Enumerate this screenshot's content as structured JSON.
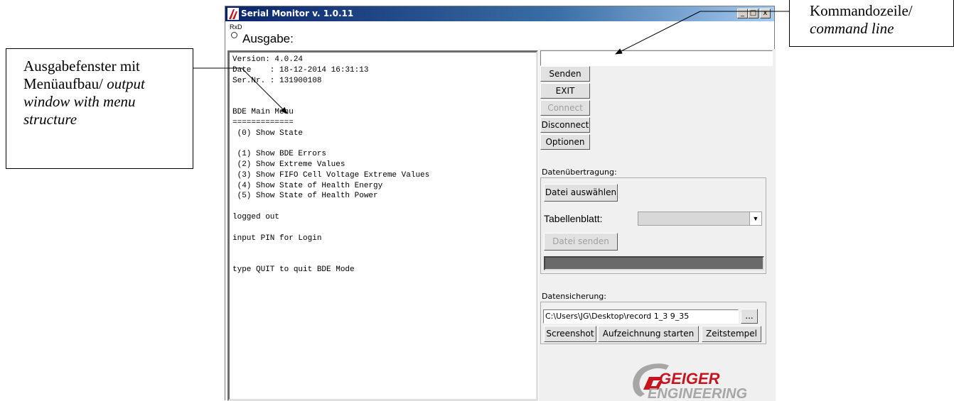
{
  "window": {
    "title": "Serial Monitor v. 1.0.11",
    "controls": {
      "minimize": "_",
      "maximize": "□",
      "close": "x"
    }
  },
  "status": {
    "rxd_label": "RxD"
  },
  "output_label": "Ausgabe:",
  "output_text": "Version: 4.0.24\nDate    : 18-12-2014 16:31:13\nSer.Nr. : 131900108\n\n\nBDE Main Menu\n=============\n (0) Show State\n\n (1) Show BDE Errors\n (2) Show Extreme Values\n (3) Show FIFO Cell Voltage Extreme Values\n (4) Show State of Health Energy\n (5) Show State of Health Power\n\nlogged out\n\ninput PIN for Login\n\n\ntype QUIT to quit BDE Mode",
  "command": {
    "value": ""
  },
  "buttons": {
    "send": "Senden",
    "exit": "EXIT",
    "connect": "Connect",
    "disconnect": "Disconnect",
    "options": "Optionen"
  },
  "transfer": {
    "label": "Datenübertragung:",
    "choose_file": "Datei auswählen",
    "sheet_label": "Tabellenblatt:",
    "sheet_value": "",
    "send_file": "Datei senden"
  },
  "backup": {
    "label": "Datensicherung:",
    "path": "C:\\Users\\JG\\Desktop\\record 1_3 9_35",
    "browse": "...",
    "screenshot": "Screenshot",
    "record": "Aufzeichnung starten",
    "timestamp": "Zeitstempel"
  },
  "logo": {
    "line1": "GEIGER",
    "line2": "ENGINEERING"
  },
  "annotations": {
    "left": {
      "normal": "Ausgabefenster mit Menüaufbau/ ",
      "italic": "output window with menu structure"
    },
    "right": {
      "normal": "Kommandozeile/ ",
      "italic": "command line"
    }
  },
  "colors": {
    "title_bar": "#0a246a",
    "panel_bg": "#f0f0f0",
    "logo_gray": "#a6a6a6",
    "logo_red": "#c8141e"
  }
}
